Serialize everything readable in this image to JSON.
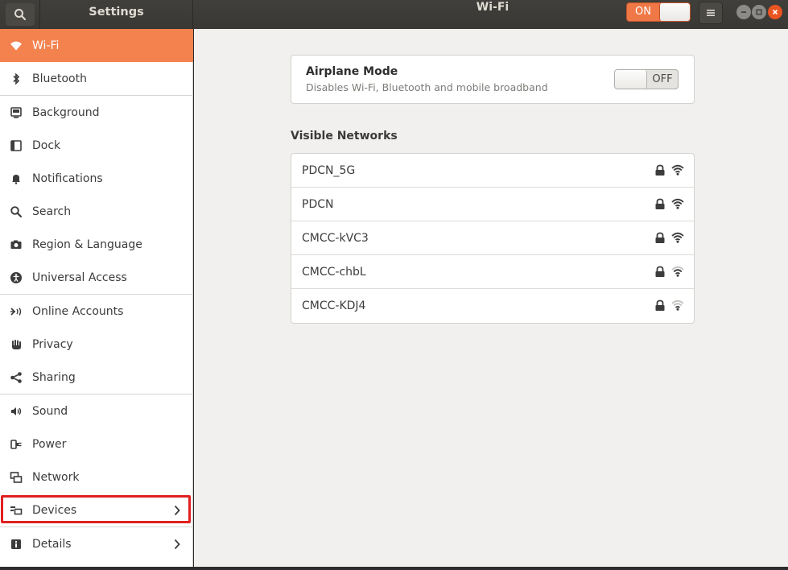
{
  "header": {
    "left_title": "Settings",
    "title": "Wi-Fi",
    "wifi_toggle_label": "ON",
    "wifi_enabled": true,
    "accent_color": "#f07746"
  },
  "sidebar": {
    "items": [
      {
        "label": "Wi-Fi",
        "icon": "wifi-icon",
        "active": true
      },
      {
        "label": "Bluetooth",
        "icon": "bluetooth-icon"
      },
      {
        "label": "Background",
        "icon": "background-icon"
      },
      {
        "label": "Dock",
        "icon": "dock-icon"
      },
      {
        "label": "Notifications",
        "icon": "bell-icon"
      },
      {
        "label": "Search",
        "icon": "search-icon"
      },
      {
        "label": "Region & Language",
        "icon": "camera-icon"
      },
      {
        "label": "Universal Access",
        "icon": "accessibility-icon"
      },
      {
        "label": "Online Accounts",
        "icon": "online-accounts-icon"
      },
      {
        "label": "Privacy",
        "icon": "hand-icon"
      },
      {
        "label": "Sharing",
        "icon": "share-icon"
      },
      {
        "label": "Sound",
        "icon": "speaker-icon"
      },
      {
        "label": "Power",
        "icon": "power-plug-icon"
      },
      {
        "label": "Network",
        "icon": "network-icon"
      },
      {
        "label": "Devices",
        "icon": "devices-icon",
        "has_submenu": true,
        "highlighted": true
      },
      {
        "label": "Details",
        "icon": "info-icon",
        "has_submenu": true
      }
    ]
  },
  "airplane": {
    "title": "Airplane Mode",
    "subtitle": "Disables Wi-Fi, Bluetooth and mobile broadband",
    "toggle_label": "OFF",
    "enabled": false
  },
  "networks": {
    "section_title": "Visible Networks",
    "items": [
      {
        "ssid": "PDCN_5G",
        "secured": true,
        "signal": "excellent"
      },
      {
        "ssid": "PDCN",
        "secured": true,
        "signal": "excellent"
      },
      {
        "ssid": "CMCC-kVC3",
        "secured": true,
        "signal": "excellent"
      },
      {
        "ssid": "CMCC-chbL",
        "secured": true,
        "signal": "good"
      },
      {
        "ssid": "CMCC-KDJ4",
        "secured": true,
        "signal": "weak"
      }
    ]
  }
}
